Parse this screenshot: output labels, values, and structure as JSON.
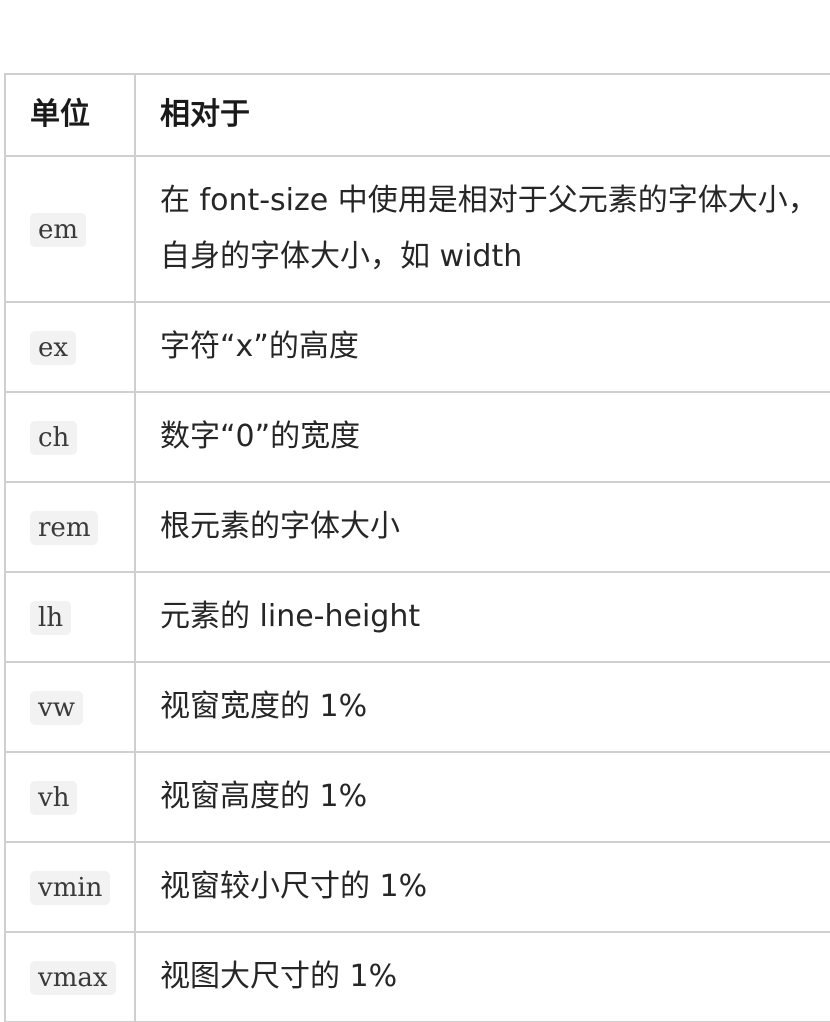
{
  "table": {
    "headers": {
      "unit": "单位",
      "relative_to": "相对于"
    },
    "rows": [
      {
        "unit": "em",
        "desc_line1": "在 font-size 中使用是相对于父元素的字体大小，",
        "desc_line2": "自身的字体大小，如 width"
      },
      {
        "unit": "ex",
        "desc": "字符“x”的高度"
      },
      {
        "unit": "ch",
        "desc": "数字“0”的宽度"
      },
      {
        "unit": "rem",
        "desc": "根元素的字体大小"
      },
      {
        "unit": "lh",
        "desc": "元素的 line-height"
      },
      {
        "unit": "vw",
        "desc": "视窗宽度的 1%"
      },
      {
        "unit": "vh",
        "desc": "视窗高度的 1%"
      },
      {
        "unit": "vmin",
        "desc": "视窗较小尺寸的 1%"
      },
      {
        "unit": "vmax",
        "desc": "视图大尺寸的 1%"
      }
    ]
  }
}
